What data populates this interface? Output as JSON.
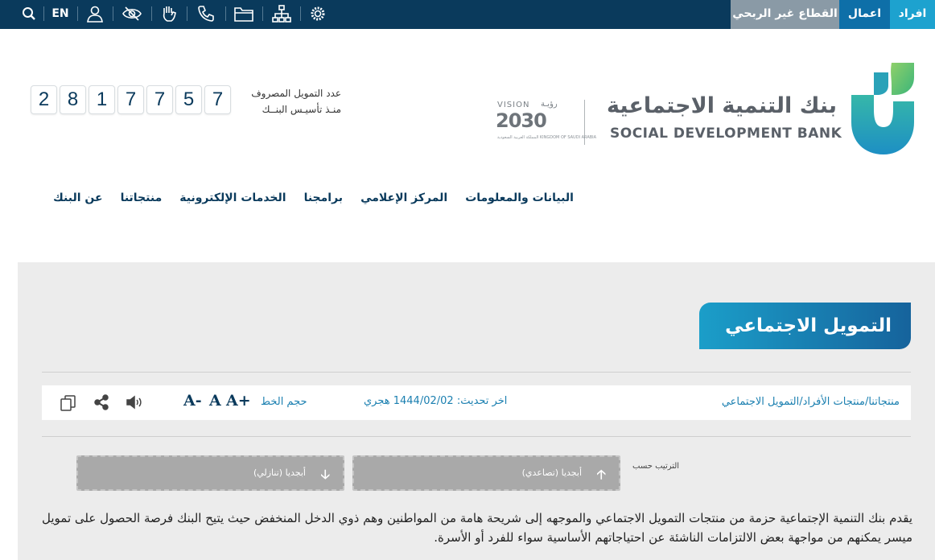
{
  "topbar": {
    "tabs": [
      "افراد",
      "اعمال",
      "القطاع غير الربحي"
    ],
    "lang": "EN",
    "icons": [
      "search-icon",
      "user-icon",
      "eye-slash-icon",
      "sign-language-icon",
      "phone-icon",
      "folder-icon",
      "sitemap-icon",
      "settings-icon"
    ]
  },
  "header": {
    "logo_ar": "بنك التنمية الاجتماعية",
    "logo_en": "SOCIAL DEVELOPMENT BANK",
    "vision_label": "VISION",
    "vision_ar": "رؤيـة",
    "vision_year": "2030",
    "vision_sub": "المملكة العربية السعودية KINGDOM OF SAUDI ARABIA",
    "counter_label_1": "عدد التمويل المصروف",
    "counter_label_2": "منـذ تأسيـس البنــك",
    "counter_digits": [
      "2",
      "8",
      "1",
      "7",
      "7",
      "5",
      "7"
    ]
  },
  "nav": [
    "عن البنك",
    "منتجاتنا",
    "الخدمات الإلكترونية",
    "برامجنا",
    "المركز الإعلامي",
    "البيانات والمعلومات"
  ],
  "page": {
    "title": "التمويل الاجتماعي",
    "breadcrumb": "منتجاتنا/منتجات الأفراد/التمويل الاجتماعي",
    "updated_label": "اخر تحديث:",
    "updated_value": "1444/02/02 هجري",
    "font_size_label": "حجم الخط",
    "font_buttons": [
      "A+",
      "A",
      "A-"
    ],
    "tool_icons": [
      "speaker-icon",
      "share-icon",
      "copy-icon"
    ],
    "sort_label": "الترتيب حسب",
    "sort_asc": "أبجديا (تصاعدي)",
    "sort_desc": "أبجديا (تنازلي)",
    "intro": "يقدم بنك التنمية الإجتماعية حزمة من منتجات التمويل الاجتماعي والموجهه إلى شريحة هامة من المواطنين وهم ذوي الدخل المنخفض حيث يتيح البنك فرصة الحصول على تمويل ميسر يمكنهم من مواجهة بعض الالتزامات الناشئة عن احتياجاتهم الأساسية سواء للفرد أو الأسرة."
  },
  "colors": {
    "navy": "#0a3a5c",
    "teal": "#1da2cf",
    "blue": "#0e6fa8",
    "gray_tab": "#8a9aa6",
    "link": "#1a7fb0",
    "content_bg": "#ececec"
  }
}
